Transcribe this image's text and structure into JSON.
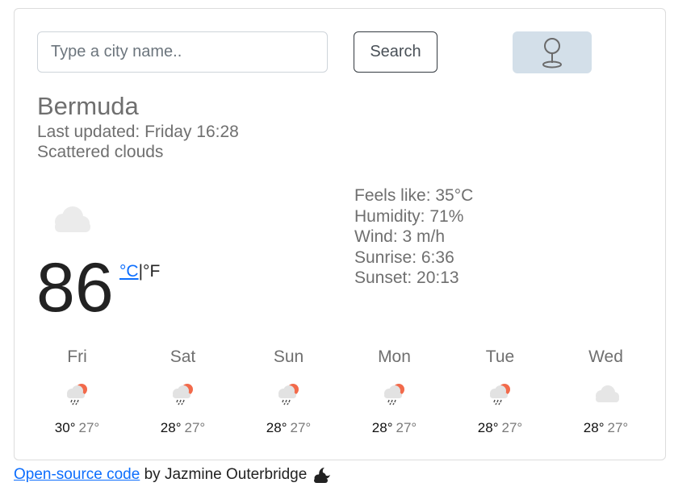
{
  "search": {
    "placeholder": "Type a city name..",
    "button_label": "Search"
  },
  "location": {
    "city": "Bermuda",
    "updated": "Last updated: Friday 16:28",
    "description": "Scattered clouds"
  },
  "current": {
    "temperature": "86",
    "unit_c": "°C",
    "unit_separator": "|",
    "unit_f": "°F",
    "icon": "cloud-icon"
  },
  "details": {
    "feels_like": "Feels like: 35°C",
    "humidity": "Humidity: 71%",
    "wind": "Wind: 3 m/h",
    "sunrise": "Sunrise: 6:36",
    "sunset": "Sunset: 20:13"
  },
  "forecast": [
    {
      "day": "Fri",
      "max": "30°",
      "min": "27°",
      "icon": "rain-sun-icon"
    },
    {
      "day": "Sat",
      "max": "28°",
      "min": "27°",
      "icon": "rain-sun-icon"
    },
    {
      "day": "Sun",
      "max": "28°",
      "min": "27°",
      "icon": "rain-sun-icon"
    },
    {
      "day": "Mon",
      "max": "28°",
      "min": "27°",
      "icon": "rain-sun-icon"
    },
    {
      "day": "Tue",
      "max": "28°",
      "min": "27°",
      "icon": "rain-sun-icon"
    },
    {
      "day": "Wed",
      "max": "28°",
      "min": "27°",
      "icon": "cloud-icon"
    }
  ],
  "footer": {
    "link_text": "Open-source code",
    "by_text": " by Jazmine Outerbridge"
  },
  "colors": {
    "accent": "#0d6efd",
    "location_button_bg": "#d3dfe9",
    "sun": "#f26a4b"
  }
}
